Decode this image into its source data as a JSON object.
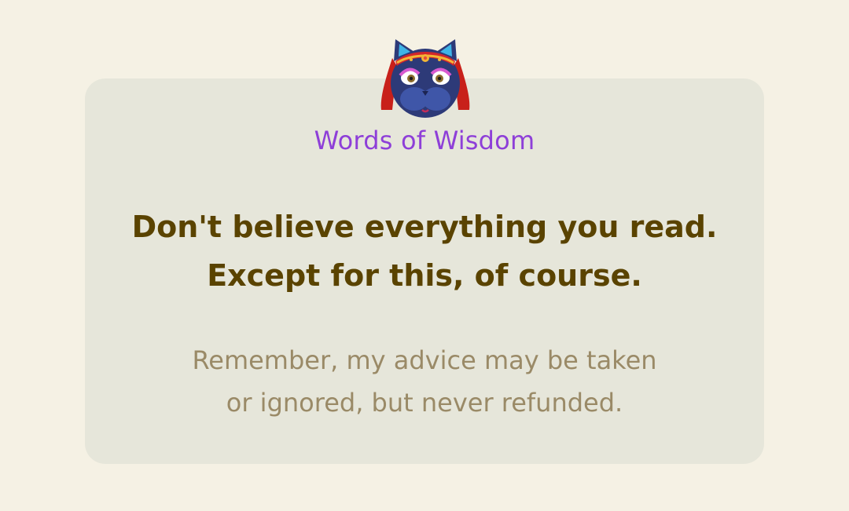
{
  "header": {
    "title": "Words of Wisdom",
    "avatar_icon": "fortune-teller-cat-icon"
  },
  "quote": {
    "line1": "Don't believe everything you read.",
    "line2": "Except for this, of course."
  },
  "footnote": {
    "line1": "Remember, my advice may be taken",
    "line2": "or ignored, but never refunded."
  },
  "colors": {
    "page_background": "#f5f1e4",
    "card_background": "#e6e6da",
    "title": "#8e3fd8",
    "quote": "#5a4300",
    "footnote": "#9a8a67"
  }
}
